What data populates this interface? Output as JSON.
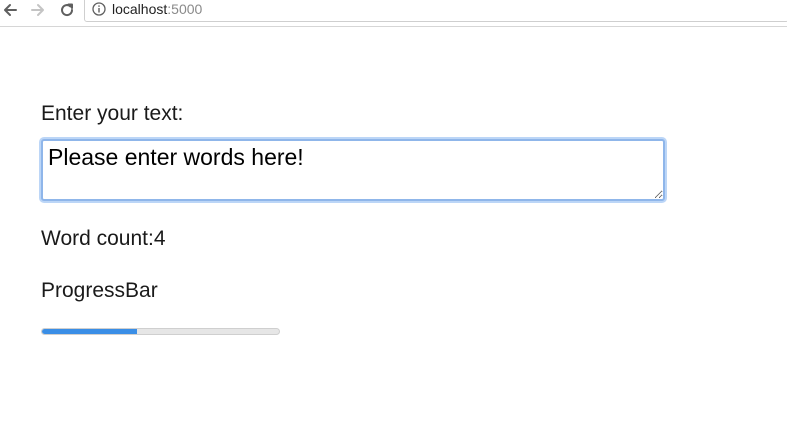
{
  "browser": {
    "url_host": "localhost",
    "url_port": ":5000",
    "icons": [
      "back-arrow-icon",
      "forward-arrow-icon",
      "reload-icon",
      "info-icon"
    ]
  },
  "form": {
    "prompt_label": "Enter your text:",
    "text_value": "Please enter words here!",
    "word_count_label": "Word count:4",
    "progress_label": "ProgressBar",
    "progress_fraction": 0.4,
    "progress_color": "#3a8ee6",
    "track_color": "#e6e6e6"
  }
}
